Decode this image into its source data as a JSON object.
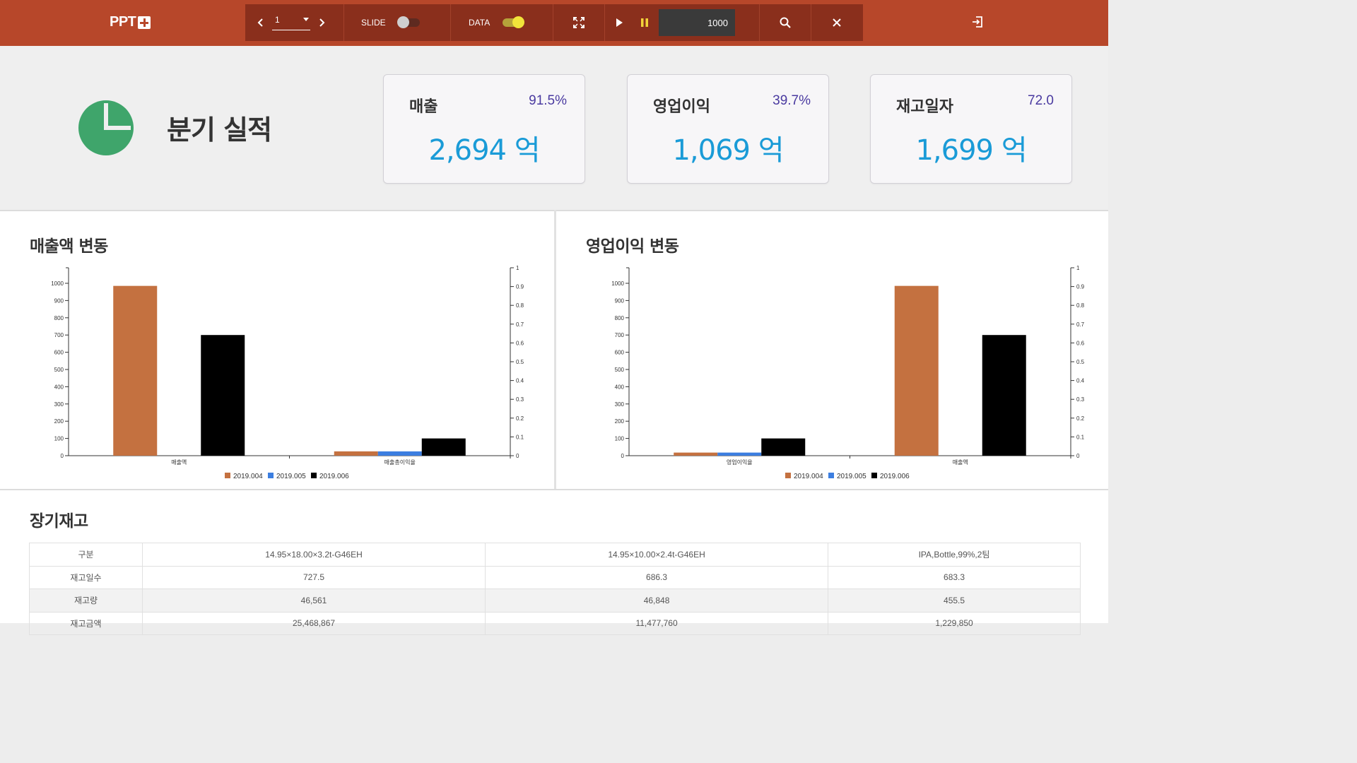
{
  "app": {
    "logo_text": "PPT"
  },
  "toolbar": {
    "page_value": "1",
    "slide_label": "SLIDE",
    "slide_toggle": "off",
    "data_label": "DATA",
    "data_toggle": "on",
    "interval_value": "1000",
    "icons": [
      "chevron-left-icon",
      "chevron-right-icon",
      "fullscreen-icon",
      "play-icon",
      "pause-icon",
      "search-icon",
      "close-icon",
      "exit-icon"
    ]
  },
  "header": {
    "title": "분기 실적"
  },
  "kpis": [
    {
      "label": "매출",
      "pct": "91.5%",
      "value": "2,694 억"
    },
    {
      "label": "영업이익",
      "pct": "39.7%",
      "value": "1,069 억"
    },
    {
      "label": "재고일자",
      "pct": "72.0",
      "value": "1,699 억"
    }
  ],
  "colors": {
    "header_bg": "#b7472a",
    "toolbar_bg": "#8a2f1c",
    "kpi_value": "#1a9bd7",
    "kpi_pct": "#4a3aa0",
    "pie": "#3fa56b",
    "series": [
      "#c47140",
      "#3c7ee0",
      "#000000"
    ]
  },
  "chart_data": [
    {
      "type": "bar",
      "title": "매출액 변동",
      "categories": [
        "매출액",
        "매출총이익율"
      ],
      "series": [
        {
          "name": "2019.004",
          "values": [
            985,
            25
          ]
        },
        {
          "name": "2019.005",
          "values": [
            0,
            25
          ]
        },
        {
          "name": "2019.006",
          "values": [
            700,
            100
          ]
        }
      ],
      "ylim": [
        0,
        1000
      ],
      "yticks": [
        "0",
        "100",
        "200",
        "300",
        "400",
        "500",
        "600",
        "700",
        "800",
        "900",
        "1000"
      ],
      "y2lim": [
        0,
        1
      ],
      "y2ticks": [
        "0",
        "0.1",
        "0.2",
        "0.3",
        "0.4",
        "0.5",
        "0.6",
        "0.7",
        "0.8",
        "0.9",
        "1"
      ],
      "legend": "bottom"
    },
    {
      "type": "bar",
      "title": "영업이익 변동",
      "categories": [
        "영업이익율",
        "매출액"
      ],
      "series": [
        {
          "name": "2019.004",
          "values": [
            18,
            985
          ]
        },
        {
          "name": "2019.005",
          "values": [
            18,
            0
          ]
        },
        {
          "name": "2019.006",
          "values": [
            100,
            700
          ]
        }
      ],
      "ylim": [
        0,
        1000
      ],
      "yticks": [
        "0",
        "100",
        "200",
        "300",
        "400",
        "500",
        "600",
        "700",
        "800",
        "900",
        "1000"
      ],
      "y2lim": [
        0,
        1
      ],
      "y2ticks": [
        "0",
        "0.1",
        "0.2",
        "0.3",
        "0.4",
        "0.5",
        "0.6",
        "0.7",
        "0.8",
        "0.9",
        "1"
      ],
      "legend": "bottom"
    }
  ],
  "inventory": {
    "title": "장기재고",
    "rows": [
      {
        "head": "구분",
        "cells": [
          "14.95×18.00×3.2t-G46EH",
          "14.95×10.00×2.4t-G46EH",
          "IPA,Bottle,99%,2팀"
        ]
      },
      {
        "head": "재고일수",
        "cells": [
          "727.5",
          "686.3",
          "683.3"
        ]
      },
      {
        "head": "재고량",
        "cells": [
          "46,561",
          "46,848",
          "455.5"
        ]
      },
      {
        "head": "재고금액",
        "cells": [
          "25,468,867",
          "11,477,760",
          "1,229,850"
        ]
      }
    ]
  }
}
